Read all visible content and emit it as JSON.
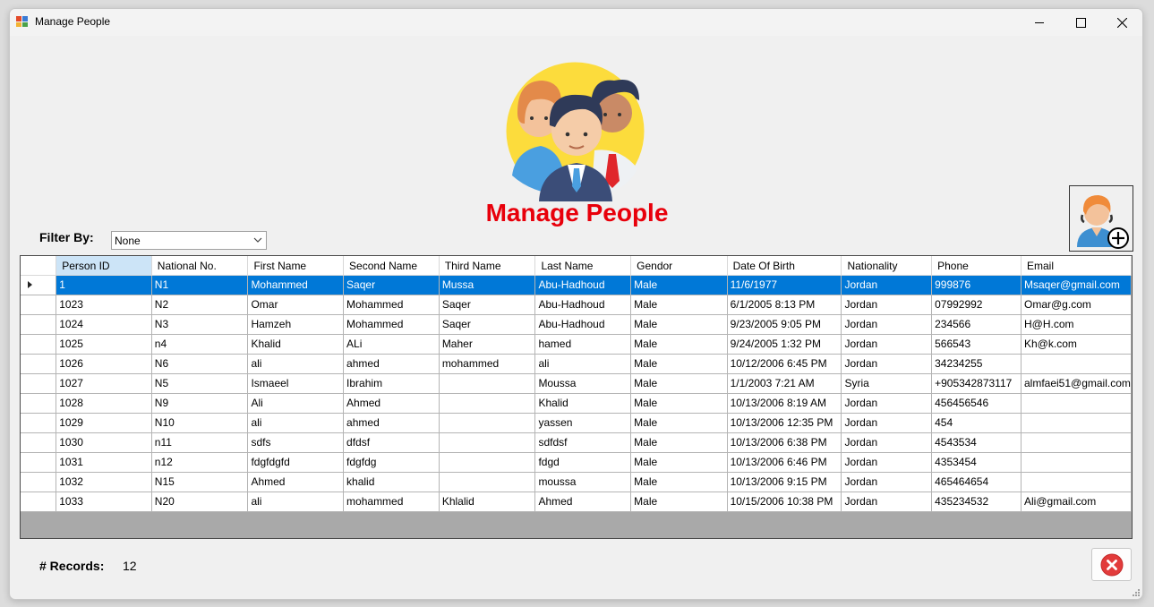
{
  "window": {
    "title": "Manage People"
  },
  "header": {
    "title": "Manage People"
  },
  "filter": {
    "label": "Filter By:",
    "selected": "None"
  },
  "table": {
    "columns": [
      "Person ID",
      "National No.",
      "First Name",
      "Second Name",
      "Third Name",
      "Last Name",
      "Gendor",
      "Date Of Birth",
      "Nationality",
      "Phone",
      "Email"
    ],
    "rows": [
      [
        "1",
        "N1",
        "Mohammed",
        "Saqer",
        "Mussa",
        "Abu-Hadhoud",
        "Male",
        "11/6/1977",
        "Jordan",
        "999876",
        "Msaqer@gmail.com"
      ],
      [
        "1023",
        "N2",
        "Omar",
        "Mohammed",
        "Saqer",
        "Abu-Hadhoud",
        "Male",
        "6/1/2005 8:13 PM",
        "Jordan",
        "07992992",
        "Omar@g.com"
      ],
      [
        "1024",
        "N3",
        "Hamzeh",
        "Mohammed",
        "Saqer",
        "Abu-Hadhoud",
        "Male",
        "9/23/2005 9:05 PM",
        "Jordan",
        "234566",
        "H@H.com"
      ],
      [
        "1025",
        "n4",
        "Khalid",
        "ALi",
        "Maher",
        "hamed",
        "Male",
        "9/24/2005 1:32 PM",
        "Jordan",
        "566543",
        "Kh@k.com"
      ],
      [
        "1026",
        "N6",
        "ali",
        "ahmed",
        "mohammed",
        "ali",
        "Male",
        "10/12/2006 6:45 PM",
        "Jordan",
        "34234255",
        ""
      ],
      [
        "1027",
        "N5",
        "Ismaeel",
        "Ibrahim",
        "",
        "Moussa",
        "Male",
        "1/1/2003 7:21 AM",
        "Syria",
        "+905342873117",
        "almfaei51@gmail.com"
      ],
      [
        "1028",
        "N9",
        "Ali",
        "Ahmed",
        "",
        "Khalid",
        "Male",
        "10/13/2006 8:19 AM",
        "Jordan",
        "456456546",
        ""
      ],
      [
        "1029",
        "N10",
        "ali",
        "ahmed",
        "",
        "yassen",
        "Male",
        "10/13/2006 12:35 PM",
        "Jordan",
        "454",
        ""
      ],
      [
        "1030",
        "n11",
        "sdfs",
        "dfdsf",
        "",
        "sdfdsf",
        "Male",
        "10/13/2006 6:38 PM",
        "Jordan",
        "4543534",
        ""
      ],
      [
        "1031",
        "n12",
        "fdgfdgfd",
        "fdgfdg",
        "",
        "fdgd",
        "Male",
        "10/13/2006 6:46 PM",
        "Jordan",
        "4353454",
        ""
      ],
      [
        "1032",
        "N15",
        "Ahmed",
        "khalid",
        "",
        "moussa",
        "Male",
        "10/13/2006 9:15 PM",
        "Jordan",
        "465464654",
        ""
      ],
      [
        "1033",
        "N20",
        "ali",
        "mohammed",
        "Khlalid",
        "Ahmed",
        "Male",
        "10/15/2006 10:38 PM",
        "Jordan",
        "435234532",
        "Ali@gmail.com"
      ]
    ]
  },
  "footer": {
    "records_label": "# Records:",
    "records_count": "12"
  },
  "colors": {
    "title_red": "#e8000b",
    "selection_blue": "#0078d7",
    "header_selected": "#cce4f7"
  },
  "icons": [
    "app-icon",
    "minimize-icon",
    "maximize-icon",
    "close-icon",
    "people-group-icon",
    "add-person-icon",
    "chevron-down-icon",
    "row-pointer-icon",
    "close-circle-icon",
    "resize-grip-icon"
  ]
}
